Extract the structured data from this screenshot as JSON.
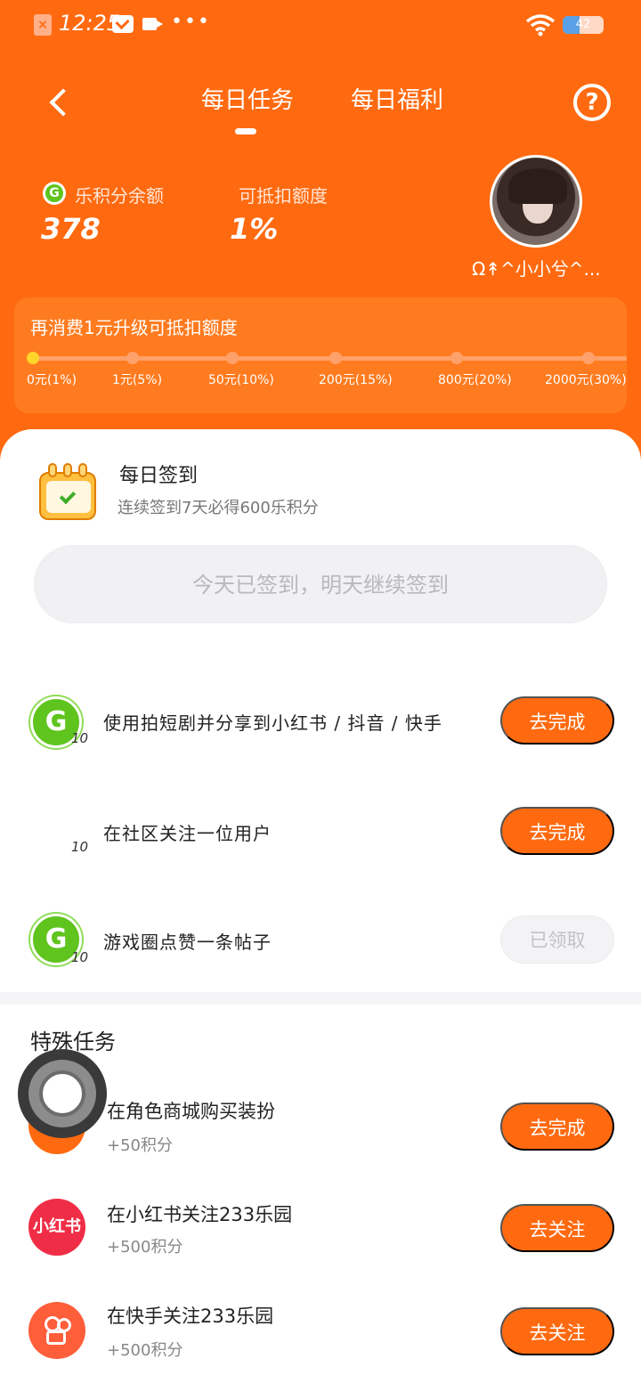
{
  "status_bar": {
    "time": "12:25",
    "battery_level": "42",
    "battery_fraction": 0.42,
    "icons": [
      "sim-error-icon",
      "mail-icon",
      "video-icon",
      "more-dots-icon",
      "wifi-icon",
      "battery-icon"
    ]
  },
  "nav": {
    "tabs": [
      {
        "label": "每日任务",
        "active": true
      },
      {
        "label": "每日福利",
        "active": false
      }
    ],
    "help_glyph": "?"
  },
  "balance": {
    "points_label": "乐积分余额",
    "points_value": "378",
    "deduct_label": "可抵扣额度",
    "deduct_value": "1%"
  },
  "user": {
    "name": "Ω↟^小小兮^..."
  },
  "progress": {
    "title": "再消费1元升级可抵扣额度",
    "current_index": 0,
    "levels": [
      "0元(1%)",
      "1元(5%)",
      "50元(10%)",
      "200元(15%)",
      "800元(20%)",
      "2000元(30%)"
    ]
  },
  "daily_sign": {
    "title": "每日签到",
    "subtitle": "连续签到7天必得600乐积分",
    "button_label": "今天已签到，明天继续签到"
  },
  "tasks": [
    {
      "points": "10",
      "title": "使用拍短剧并分享到小红书 / 抖音 / 快手",
      "button": "去完成",
      "done": false,
      "show_coin": true
    },
    {
      "points": "10",
      "title": "在社区关注一位用户",
      "button": "去完成",
      "done": false,
      "show_coin": false
    },
    {
      "points": "10",
      "title": "游戏圈点赞一条帖子",
      "button": "已领取",
      "done": true,
      "show_coin": true
    }
  ],
  "special": {
    "section_title": "特殊任务",
    "items": [
      {
        "title": "在角色商城购买装扮",
        "sub": "+50积分",
        "button": "去完成",
        "icon": "role-shop-icon"
      },
      {
        "title": "在小红书关注233乐园",
        "sub": "+500积分",
        "button": "去关注",
        "icon": "xiaohongshu-icon",
        "icon_text": "小红书"
      },
      {
        "title": "在快手关注233乐园",
        "sub": "+500积分",
        "button": "去关注",
        "icon": "kuaishou-icon"
      }
    ]
  },
  "colors": {
    "brand_orange": "#ff6a10",
    "coin_green": "#5fc41e",
    "xhs_red": "#f02d46",
    "progress_active": "#ffd52a"
  }
}
